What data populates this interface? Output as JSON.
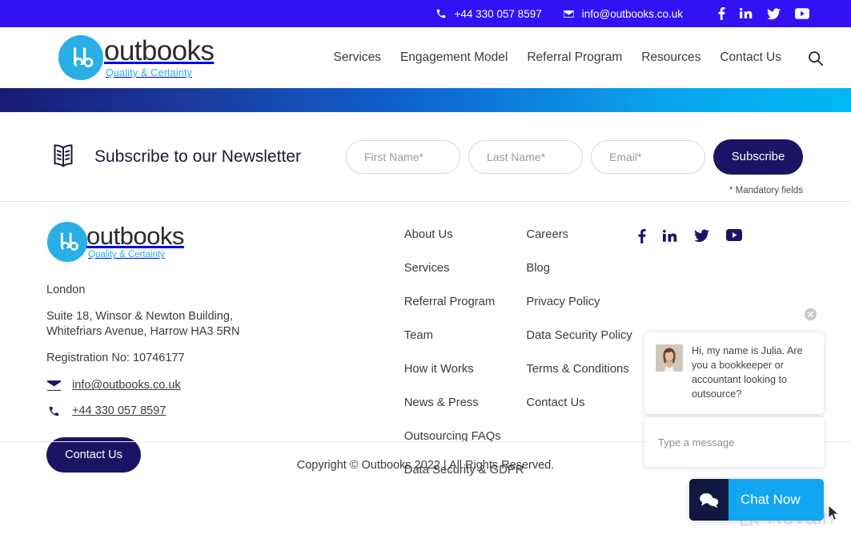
{
  "topbar": {
    "phone": "+44 330 057 8597",
    "email": "info@outbooks.co.uk",
    "phone_icon": "phone-icon",
    "email_icon": "envelope-icon",
    "social": [
      {
        "name": "facebook-icon",
        "label": "Facebook"
      },
      {
        "name": "linkedin-icon",
        "label": "LinkedIn"
      },
      {
        "name": "twitter-icon",
        "label": "Twitter"
      },
      {
        "name": "youtube-icon",
        "label": "YouTube"
      }
    ],
    "background_color": "#3311f5"
  },
  "header": {
    "logo": {
      "word": "outbooks",
      "tagline": "Quality & Certainty",
      "mark_text": "ob",
      "mark_color": "#29aee5",
      "word_color": "#2b2b2b"
    },
    "nav": [
      {
        "label": "Services"
      },
      {
        "label": "Engagement Model"
      },
      {
        "label": "Referral Program"
      },
      {
        "label": "Resources"
      },
      {
        "label": "Contact Us"
      }
    ],
    "search_icon": "search-icon"
  },
  "gradient_bar": {
    "from_color": "#171b76",
    "to_color": "#00b9f5"
  },
  "newsletter": {
    "icon": "open-book-icon",
    "title": "Subscribe to our Newsletter",
    "first_name_placeholder": "First Name*",
    "last_name_placeholder": "Last Name*",
    "email_placeholder": "Email*",
    "first_name_value": "",
    "last_name_value": "",
    "email_value": "",
    "submit_label": "Subscribe",
    "mandatory_note": "* Mandatory fields",
    "submit_color": "#1b1464"
  },
  "footer": {
    "logo": {
      "word": "outbooks",
      "tagline": "Quality & Certainty",
      "mark_text": "ob"
    },
    "city": "London",
    "address_line1": "Suite 18, Winsor & Newton Building,",
    "address_line2": "Whitefriars Avenue, Harrow HA3 5RN",
    "registration": "Registration No: 10746177",
    "email": "info@outbooks.co.uk",
    "email_icon": "envelope-icon",
    "phone": "+44 330 057 8597",
    "phone_icon": "phone-icon",
    "cta_label": "Contact Us",
    "links_column_1": [
      {
        "label": "About Us"
      },
      {
        "label": "Services"
      },
      {
        "label": "Referral Program"
      },
      {
        "label": "Team"
      },
      {
        "label": "How it Works"
      },
      {
        "label": "News & Press"
      },
      {
        "label": "Outsourcing FAQs"
      },
      {
        "label": "Data Security & GDPR"
      }
    ],
    "links_column_2": [
      {
        "label": "Careers"
      },
      {
        "label": "Blog"
      },
      {
        "label": "Privacy Policy"
      },
      {
        "label": "Data Security Policy"
      },
      {
        "label": "Terms & Conditions"
      },
      {
        "label": "Contact Us"
      }
    ],
    "social": [
      {
        "name": "facebook-icon",
        "label": "Facebook"
      },
      {
        "name": "linkedin-icon",
        "label": "LinkedIn"
      },
      {
        "name": "twitter-icon",
        "label": "Twitter"
      },
      {
        "name": "youtube-icon",
        "label": "YouTube"
      }
    ],
    "social_color": "#1b1464"
  },
  "copyright": {
    "text": "Copyright © Outbooks 2022 | All Rights Reserved."
  },
  "chat": {
    "close_icon": "close-icon",
    "avatar": "agent-avatar",
    "message": "Hi, my name is Julia. Are you a bookkeeper or accountant looking to outsource?",
    "input_placeholder": "Type a message",
    "input_value": "",
    "button_label": "Chat Now",
    "button_icon": "chat-bubble-icon",
    "button_icon_bg": "#111840",
    "button_label_bg": "#12a5f0"
  },
  "watermark": {
    "text": "Revain",
    "icon": "revain-logo-icon"
  }
}
